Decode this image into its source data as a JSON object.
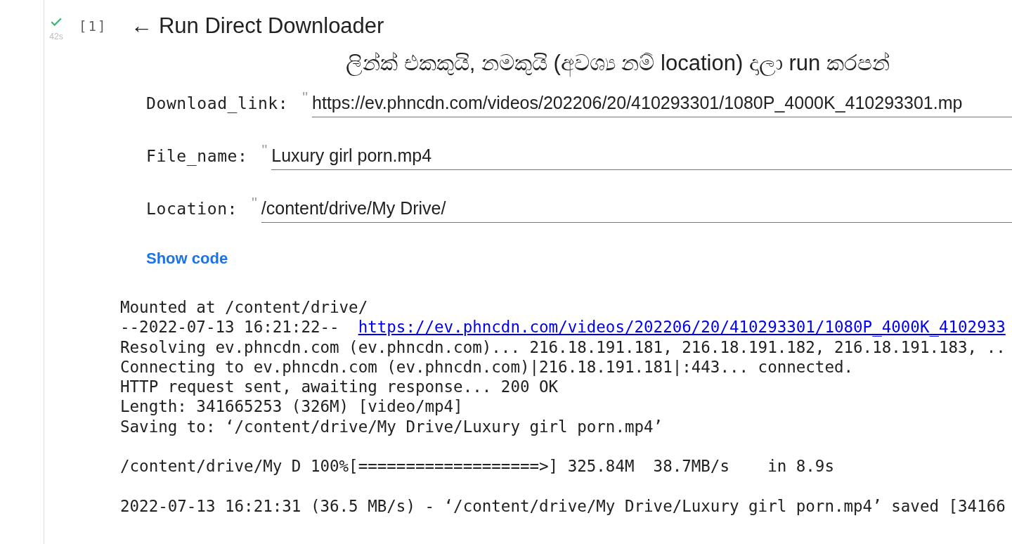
{
  "cell": {
    "succeeded": true,
    "duration": "42s",
    "execution_count": "[1]"
  },
  "title": "← Run Direct Downloader",
  "subtitle": "ලින්ක් එකකුයි, නමකුයි (අවශ්‍ය නම් location) දාලා run කරපන්",
  "fields": [
    {
      "label": "Download_link:",
      "prefix": "\"",
      "value": "https://ev.phncdn.com/videos/202206/20/410293301/1080P_4000K_410293301.mp"
    },
    {
      "label": "File_name:",
      "prefix": "\"",
      "value": "Luxury girl porn.mp4"
    },
    {
      "label": "Location:",
      "prefix": "\"",
      "value": "/content/drive/My Drive/"
    }
  ],
  "show_code": "Show code",
  "output": {
    "blocks": [
      [
        {
          "text": "Mounted at /content/drive/"
        },
        {
          "text": "--2022-07-13 16:21:22--  ",
          "link": "https://ev.phncdn.com/videos/202206/20/410293301/1080P_4000K_4102933"
        },
        {
          "text": "Resolving ev.phncdn.com (ev.phncdn.com)... 216.18.191.181, 216.18.191.182, 216.18.191.183, .."
        },
        {
          "text": "Connecting to ev.phncdn.com (ev.phncdn.com)|216.18.191.181|:443... connected."
        },
        {
          "text": "HTTP request sent, awaiting response... 200 OK"
        },
        {
          "text": "Length: 341665253 (326M) [video/mp4]"
        },
        {
          "text": "Saving to: ‘/content/drive/My Drive/Luxury girl porn.mp4’"
        }
      ],
      [
        {
          "text": "/content/drive/My D 100%[===================>] 325.84M  38.7MB/s    in 8.9s"
        }
      ],
      [
        {
          "text": "2022-07-13 16:21:31 (36.5 MB/s) - ‘/content/drive/My Drive/Luxury girl porn.mp4’ saved [34166"
        }
      ]
    ]
  }
}
